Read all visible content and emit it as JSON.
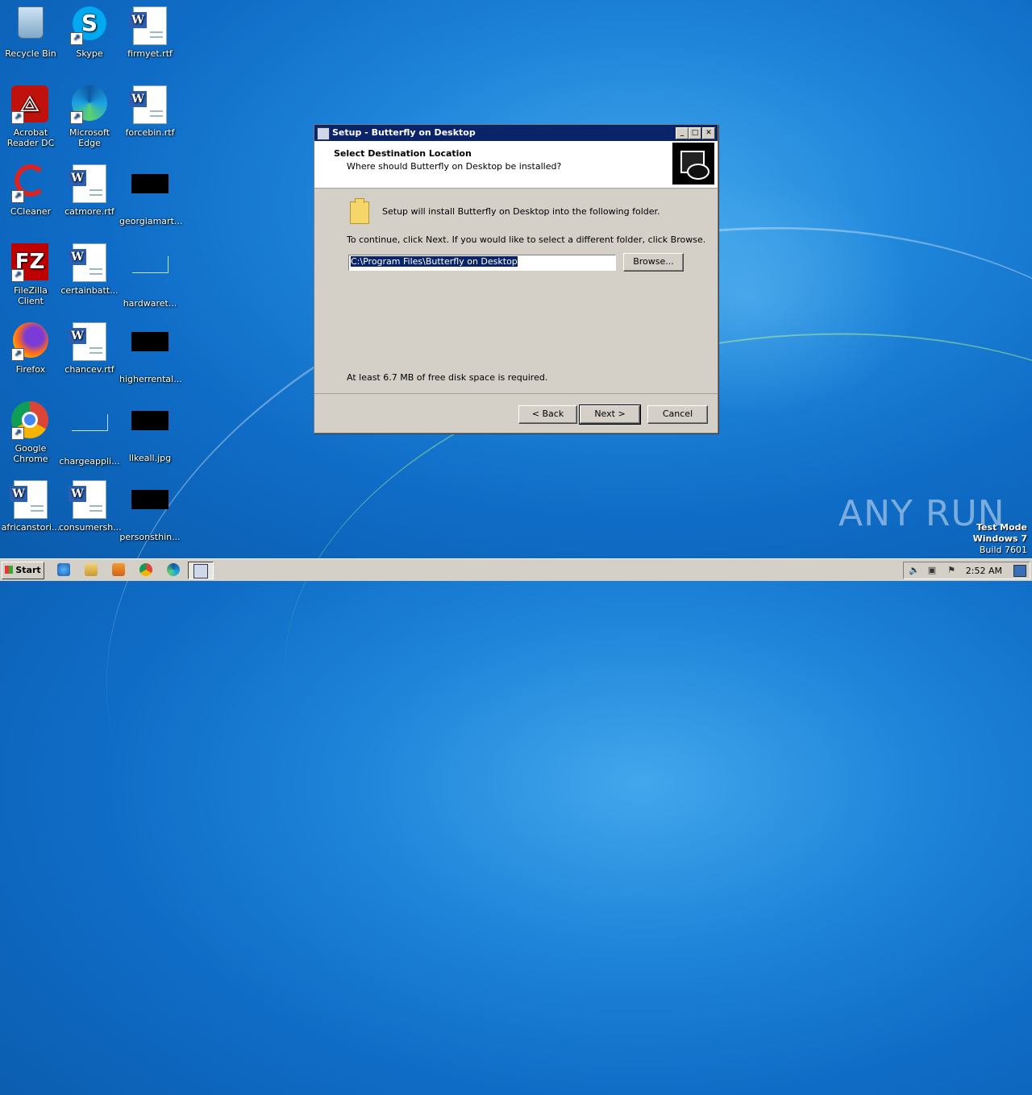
{
  "desktop": {
    "icons": [
      {
        "label": "Recycle Bin"
      },
      {
        "label": "Skype"
      },
      {
        "label": "firmyet.rtf"
      },
      {
        "label": "Acrobat Reader DC"
      },
      {
        "label": "Microsoft Edge"
      },
      {
        "label": "forcebin.rtf"
      },
      {
        "label": "CCleaner"
      },
      {
        "label": "catmore.rtf"
      },
      {
        "label": "georgiamart..."
      },
      {
        "label": "FileZilla Client"
      },
      {
        "label": "certainbatt..."
      },
      {
        "label": "hardwaret..."
      },
      {
        "label": "Firefox"
      },
      {
        "label": "chancev.rtf"
      },
      {
        "label": "higherrental..."
      },
      {
        "label": "Google Chrome"
      },
      {
        "label": "chargeappli..."
      },
      {
        "label": "llkeall.jpg"
      },
      {
        "label": "africanstori..."
      },
      {
        "label": "consumersh..."
      },
      {
        "label": "personsthin..."
      }
    ]
  },
  "dialog": {
    "title": "Setup - Butterfly on Desktop",
    "heading": "Select Destination Location",
    "subheading": "Where should Butterfly on Desktop be installed?",
    "info": "Setup will install Butterfly on Desktop into the following folder.",
    "instruction": "To continue, click Next. If you would like to select a different folder, click Browse.",
    "path_value": "C:\\Program Files\\Butterfly on Desktop",
    "browse_label": "Browse...",
    "disk_space": "At least 6.7 MB of free disk space is required.",
    "back_label": "< Back",
    "next_label": "Next >",
    "cancel_label": "Cancel"
  },
  "taskbar": {
    "start_label": "Start",
    "clock": "2:52 AM"
  },
  "watermark": "ANY RUN",
  "system": {
    "line1": "Test Mode",
    "line2": "Windows 7",
    "line3": "Build 7601"
  }
}
